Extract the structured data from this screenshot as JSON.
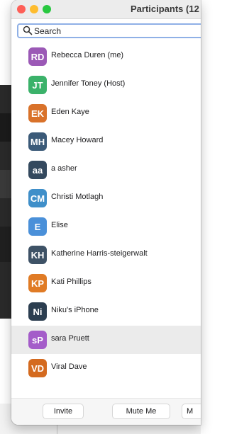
{
  "window": {
    "title": "Participants (12",
    "traffic_lights": {
      "close": "#fe5f57",
      "minimize": "#febc2e",
      "zoom": "#28c840"
    }
  },
  "search": {
    "placeholder": "Search",
    "value": "",
    "icon": "search-icon"
  },
  "participants": [
    {
      "initials": "RD",
      "name": "Rebecca Duren (me)",
      "color": "#9b59b6",
      "selected": false
    },
    {
      "initials": "JT",
      "name": "Jennifer Toney (Host)",
      "color": "#3bb26a",
      "selected": false
    },
    {
      "initials": "EK",
      "name": "Eden Kaye",
      "color": "#d9722a",
      "selected": false
    },
    {
      "initials": "MH",
      "name": "Macey Howard",
      "color": "#3b5a78",
      "selected": false
    },
    {
      "initials": "aa",
      "name": "a asher",
      "color": "#34495e",
      "selected": false
    },
    {
      "initials": "CM",
      "name": "Christi Motlagh",
      "color": "#3f8fc9",
      "selected": false
    },
    {
      "initials": "E",
      "name": "Elise",
      "color": "#4a90d9",
      "selected": false
    },
    {
      "initials": "KH",
      "name": "Katherine Harris-steigerwalt",
      "color": "#3e5266",
      "selected": false
    },
    {
      "initials": "KP",
      "name": "Kati Phillips",
      "color": "#e07b25",
      "selected": false
    },
    {
      "initials": "Ni",
      "name": "Niku's iPhone",
      "color": "#2c3e50",
      "selected": false
    },
    {
      "initials": "sP",
      "name": "sara Pruett",
      "color": "#a45cc9",
      "selected": true
    },
    {
      "initials": "VD",
      "name": "Viral Dave",
      "color": "#d46a1f",
      "selected": false
    }
  ],
  "footer": {
    "invite_label": "Invite",
    "mute_label": "Mute Me",
    "more_label": "M"
  }
}
